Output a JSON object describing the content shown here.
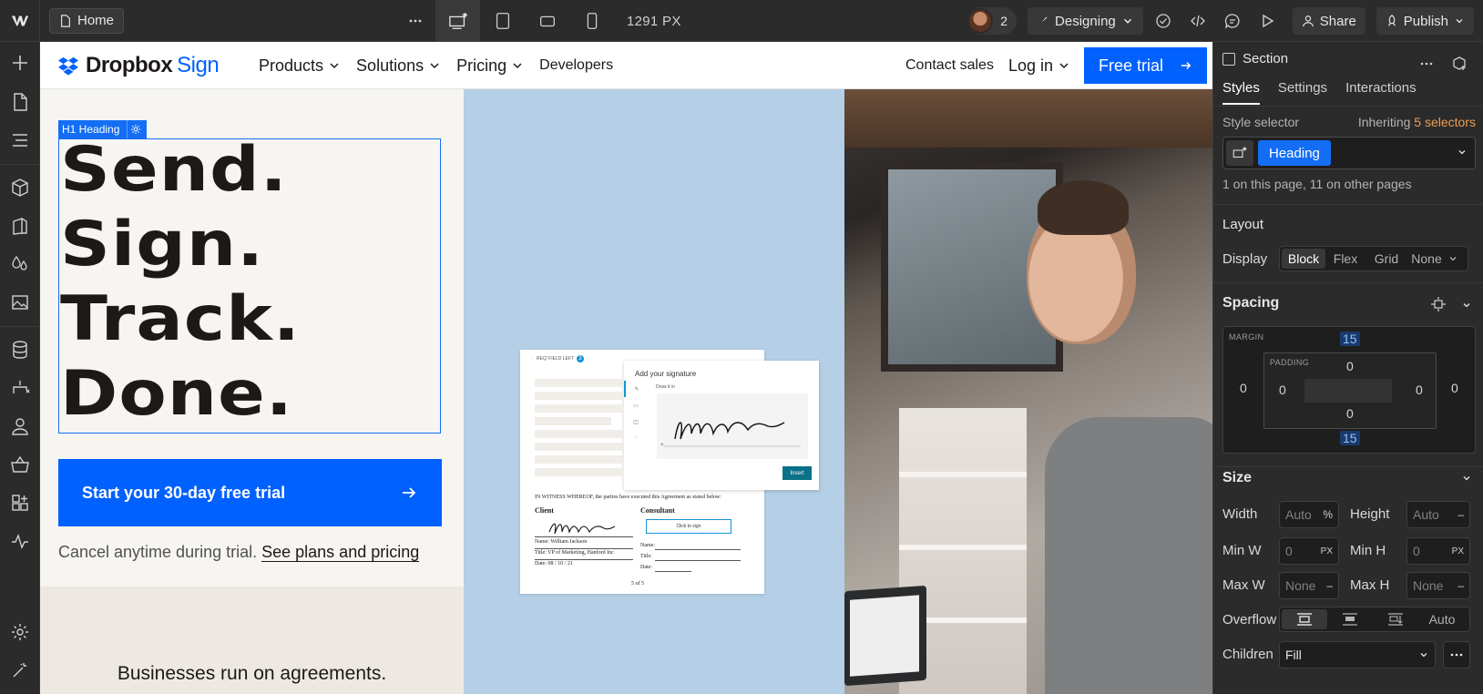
{
  "topbar": {
    "home_label": "Home",
    "px_readout": "1291 PX",
    "collaborator_count": "2",
    "mode_label": "Designing",
    "share_label": "Share",
    "publish_label": "Publish"
  },
  "site": {
    "brand": "Dropbox",
    "brand_product": "Sign",
    "nav": [
      "Products",
      "Solutions",
      "Pricing",
      "Developers"
    ],
    "contact": "Contact sales",
    "login": "Log in",
    "free_trial": "Free trial",
    "selection_tag": "H1  Heading",
    "hero_lines": [
      "Send.",
      "Sign.",
      "Track.",
      "Done."
    ],
    "cta": "Start your 30-day free trial",
    "cancel_text": "Cancel anytime during trial.",
    "cancel_link": "See plans and pricing",
    "tagline": "Businesses run on agreements."
  },
  "doc": {
    "req_field": "REQ' FIELD LEFT",
    "req_count": "3",
    "witness": "IN WITNESS WHEREOF, the parties have executed this Agreement as stated below:",
    "client": "Client",
    "consultant": "Consultant",
    "client_name": "Name: William Jackson",
    "client_title": "Title: VP of Marketing, Hanford Inc",
    "client_date": "Date: 08 / 10 / 21",
    "consultant_name": "Name:",
    "consultant_title": "Title:",
    "consultant_date": "Date:",
    "click_to_sign": "Click to sign",
    "page_num": "5 of 5",
    "modal_title": "Add your signature",
    "modal_sub": "Draw it in",
    "insert": "Insert"
  },
  "panel": {
    "element_type": "Section",
    "tabs": [
      "Styles",
      "Settings",
      "Interactions"
    ],
    "style_selector_label": "Style selector",
    "inheriting_label": "Inheriting",
    "inheriting_count": "5 selectors",
    "selector_chip": "Heading",
    "usage": "1 on this page, 11 on other pages",
    "layout_title": "Layout",
    "display_label": "Display",
    "display_options": [
      "Block",
      "Flex",
      "Grid",
      "None"
    ],
    "spacing_title": "Spacing",
    "margin_label": "MARGIN",
    "padding_label": "PADDING",
    "margin": {
      "top": "15",
      "bottom": "15",
      "left": "0",
      "right": "0"
    },
    "padding": {
      "top": "0",
      "bottom": "0",
      "left": "0",
      "right": "0"
    },
    "size_title": "Size",
    "width_label": "Width",
    "width_value": "Auto",
    "width_unit": "%",
    "height_label": "Height",
    "height_value": "Auto",
    "height_unit": "–",
    "minw_label": "Min W",
    "minw_value": "0",
    "minw_unit": "PX",
    "minh_label": "Min H",
    "minh_value": "0",
    "minh_unit": "PX",
    "maxw_label": "Max W",
    "maxw_value": "None",
    "maxw_unit": "–",
    "maxh_label": "Max H",
    "maxh_value": "None",
    "maxh_unit": "–",
    "overflow_label": "Overflow",
    "overflow_auto": "Auto",
    "children_label": "Children",
    "children_value": "Fill"
  },
  "colors": {
    "accent": "#146ef5",
    "dropbox_blue": "#0061fe",
    "orange_hint": "#ed9c52"
  }
}
